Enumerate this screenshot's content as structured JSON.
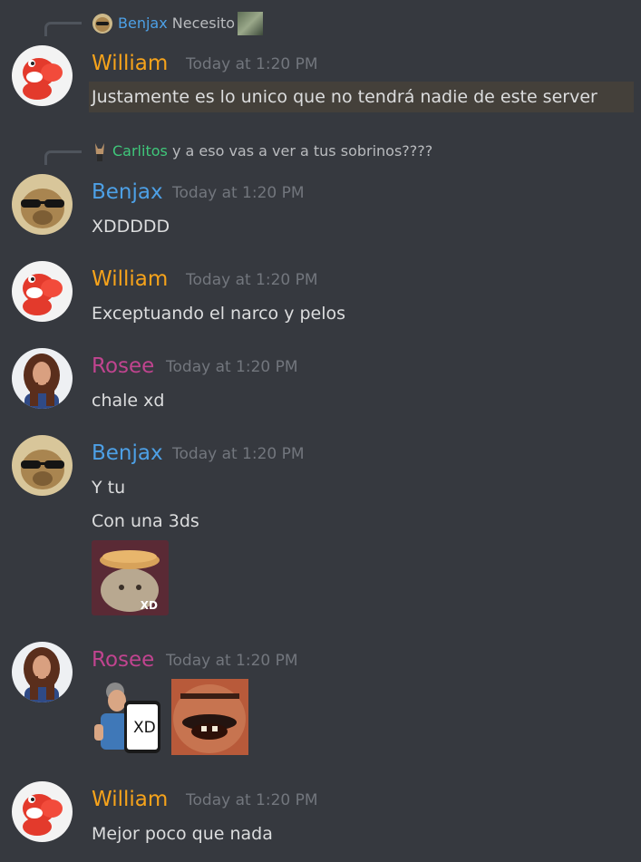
{
  "messages": [
    {
      "reply": {
        "author": "Benjax",
        "text": "Necesito"
      },
      "author": "William",
      "time": "Today at 1:20 PM",
      "text": "Justamente es lo unico que no tendrá nadie de este server"
    },
    {
      "reply": {
        "author": "Carlitos",
        "text": "y a eso vas a ver a tus sobrinos????"
      },
      "author": "Benjax",
      "time": "Today at 1:20 PM",
      "text": "XDDDDD"
    },
    {
      "author": "William",
      "time": "Today at 1:20 PM",
      "text": "Exceptuando el narco y pelos"
    },
    {
      "author": "Rosee",
      "time": "Today at 1:20 PM",
      "text": "chale xd"
    },
    {
      "author": "Benjax",
      "time": "Today at 1:20 PM",
      "lines": [
        "Y tu",
        "Con una 3ds"
      ],
      "sticker_text": "XD"
    },
    {
      "author": "Rosee",
      "time": "Today at 1:20 PM",
      "emoji_text": "XD"
    },
    {
      "author": "William",
      "time": "Today at 1:20 PM",
      "text": "Mejor poco que nada"
    }
  ],
  "colors": {
    "background": "#36393f",
    "william": "#f6a31b",
    "benjax": "#4da0e6",
    "rosee": "#c0448f",
    "carlitos": "#3fc77a",
    "timestamp": "#72767d"
  }
}
